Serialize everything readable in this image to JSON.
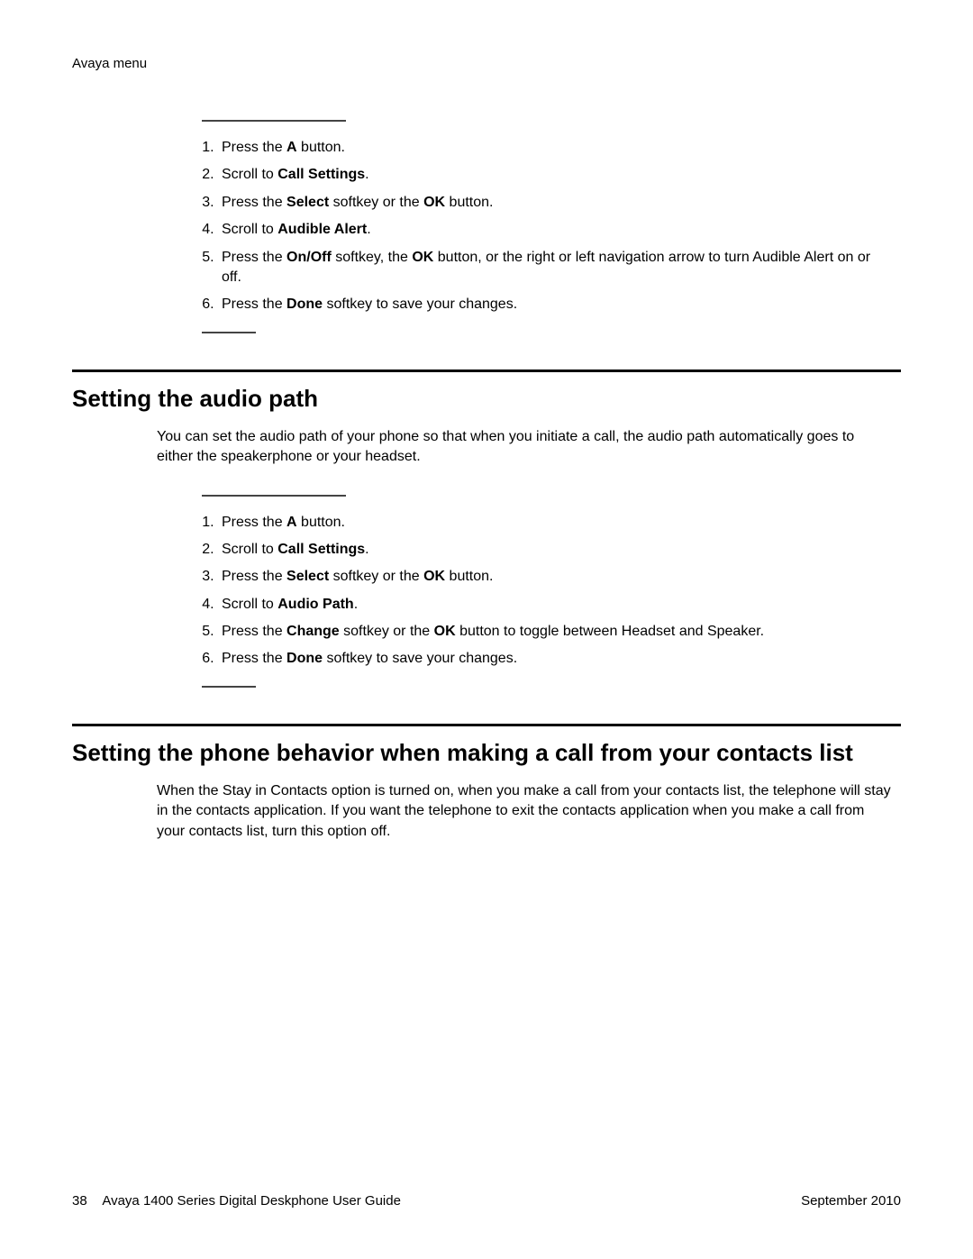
{
  "running_head": "Avaya menu",
  "proc1": {
    "steps": [
      {
        "pre": "Press the ",
        "b": "A",
        "post": " button."
      },
      {
        "pre": "Scroll to ",
        "b": "Call Settings",
        "post": "."
      },
      {
        "pre": "Press the ",
        "b": "Select",
        "mid": " softkey or the ",
        "b2": "OK",
        "post": " button."
      },
      {
        "pre": "Scroll to ",
        "b": "Audible Alert",
        "post": "."
      },
      {
        "pre": "Press the ",
        "b": "On/Off",
        "mid": " softkey, the ",
        "b2": "OK",
        "post": " button, or the right or left navigation arrow to turn Audible Alert on or off."
      },
      {
        "pre": "Press the ",
        "b": "Done",
        "post": " softkey to save your changes."
      }
    ]
  },
  "sect2": {
    "title": "Setting the audio path",
    "intro": "You can set the audio path of your phone so that when you initiate a call, the audio path automatically goes to either the speakerphone or your headset.",
    "steps": [
      {
        "pre": "Press the ",
        "b": "A",
        "post": " button."
      },
      {
        "pre": "Scroll to ",
        "b": "Call Settings",
        "post": "."
      },
      {
        "pre": "Press the ",
        "b": "Select",
        "mid": " softkey or the ",
        "b2": "OK",
        "post": " button."
      },
      {
        "pre": "Scroll to ",
        "b": "Audio Path",
        "post": "."
      },
      {
        "pre": "Press the ",
        "b": "Change",
        "mid": " softkey or the ",
        "b2": "OK",
        "post": " button to toggle between Headset and Speaker."
      },
      {
        "pre": "Press the ",
        "b": "Done",
        "post": " softkey to save your changes."
      }
    ]
  },
  "sect3": {
    "title": "Setting the phone behavior when making a call from your contacts list",
    "intro": "When the Stay in Contacts option is turned on, when you make a call from your contacts list, the telephone will stay in the contacts application. If you want the telephone to exit the contacts application when you make a call from your contacts list, turn this option off."
  },
  "footer": {
    "page": "38",
    "title": "Avaya 1400 Series Digital Deskphone User Guide",
    "date": "September 2010"
  }
}
